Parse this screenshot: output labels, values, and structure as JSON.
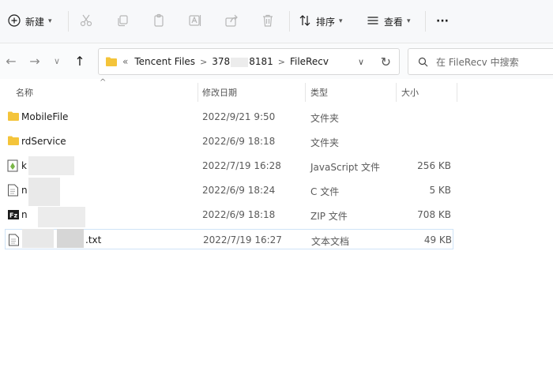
{
  "toolbar": {
    "new_label": "新建",
    "sort_label": "排序",
    "view_label": "查看",
    "more_label": "···"
  },
  "nav": {
    "back": "←",
    "forward": "→",
    "recent": "∨",
    "up": "↑",
    "dropdown": "∨",
    "refresh": "↻"
  },
  "address": {
    "overflow": "«",
    "crumbs": [
      "Tencent Files",
      "378",
      "8181",
      "FileRecv"
    ],
    "sep": ">"
  },
  "search": {
    "placeholder": "在 FileRecv 中搜索"
  },
  "columns": {
    "name": "名称",
    "modified": "修改日期",
    "type": "类型",
    "size": "大小",
    "sort_arrow": "^"
  },
  "files": [
    {
      "name": "MobileFile",
      "modified": "2022/9/21 9:50",
      "type": "文件夹",
      "size": "",
      "icon": "folder-icon"
    },
    {
      "name": "rdService",
      "modified": "2022/6/9 18:18",
      "type": "文件夹",
      "size": "",
      "icon": "folder-icon"
    },
    {
      "name": "k",
      "modified": "2022/7/19 16:28",
      "type": "JavaScript 文件",
      "size": "256 KB",
      "icon": "js-file-icon"
    },
    {
      "name": "n",
      "modified": "2022/6/9 18:24",
      "type": "C 文件",
      "size": "5 KB",
      "icon": "c-file-icon"
    },
    {
      "name": "n",
      "modified": "2022/6/9 18:18",
      "type": "ZIP 文件",
      "size": "708 KB",
      "icon": "zip-file-icon"
    },
    {
      "name": ".txt",
      "modified": "2022/7/19 16:27",
      "type": "文本文档",
      "size": "49 KB",
      "icon": "text-file-icon"
    }
  ],
  "colors": {
    "folder": "#f4c43a",
    "accent": "#1a73c9",
    "selected_border": "#cfe3f7"
  }
}
